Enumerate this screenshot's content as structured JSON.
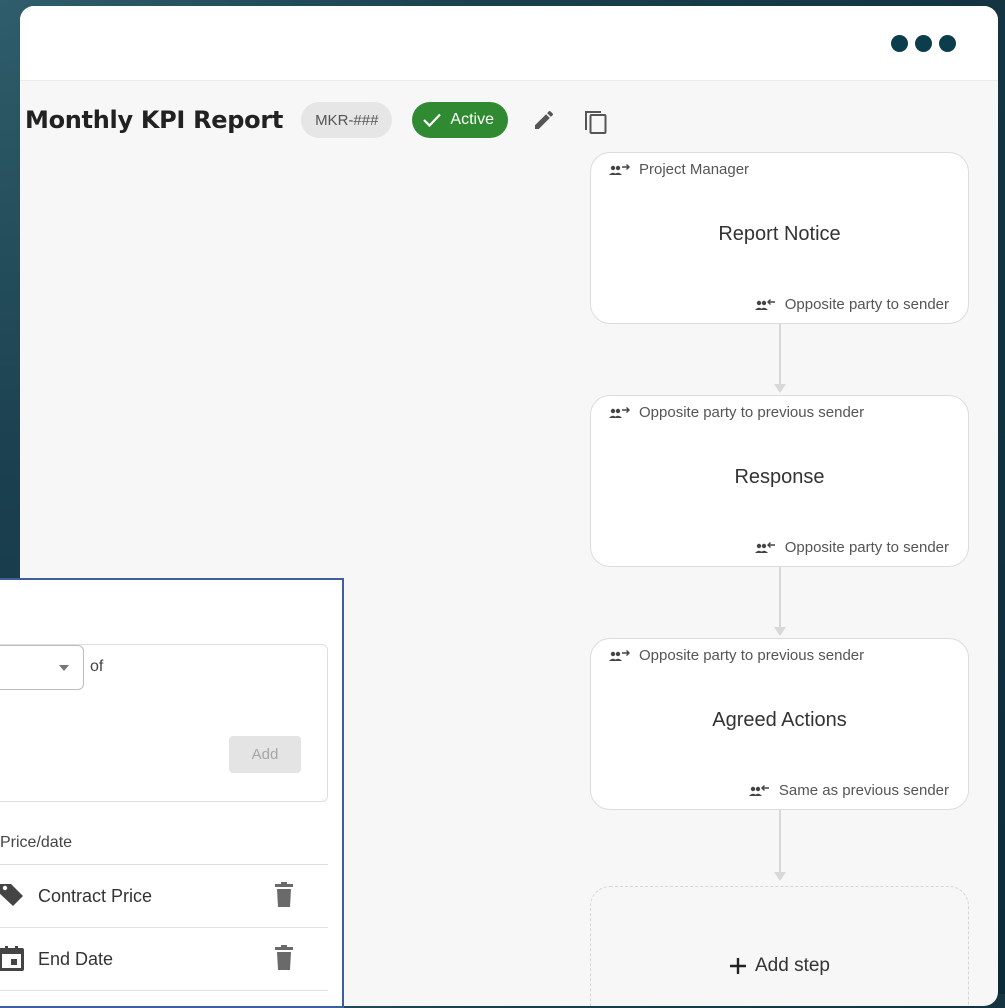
{
  "header": {
    "title": "Monthly KPI Report",
    "code": "MKR-###",
    "status": "Active",
    "status_color": "#2f8a32",
    "icons": [
      "more-dots-icon",
      "pencil-icon",
      "copy-icon"
    ]
  },
  "workflow": {
    "steps": [
      {
        "from": "Project Manager",
        "name": "Report Notice",
        "to": "Opposite party to sender"
      },
      {
        "from": "Opposite party to previous sender",
        "name": "Response",
        "to": "Opposite party to sender"
      },
      {
        "from": "Opposite party to previous sender",
        "name": "Agreed Actions",
        "to": "Same as previous sender"
      }
    ],
    "add_step_label": "Add step"
  },
  "panel": {
    "of_label": "of",
    "add_button_label": "Add",
    "column_header": "Price/date",
    "rows": [
      {
        "icon": "tag-icon",
        "label": "Contract Price"
      },
      {
        "icon": "calendar-icon",
        "label": "End Date"
      }
    ]
  }
}
